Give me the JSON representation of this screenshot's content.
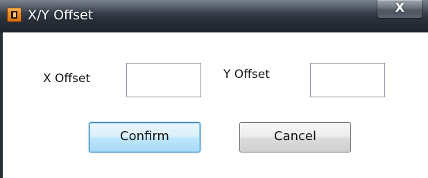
{
  "window": {
    "title": "X/Y Offset",
    "close_label": "X"
  },
  "form": {
    "x_offset_label": "X Offset",
    "x_offset_value": "",
    "y_offset_label": "Y Offset",
    "y_offset_value": ""
  },
  "buttons": {
    "confirm_label": "Confirm",
    "cancel_label": "Cancel"
  },
  "icons": {
    "app_icon": "app-icon",
    "close_icon": "close-icon"
  }
}
